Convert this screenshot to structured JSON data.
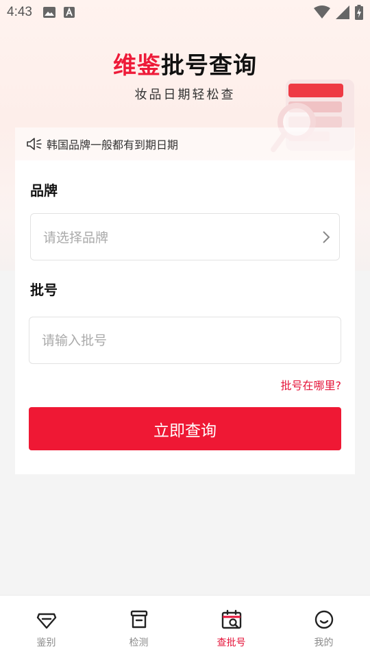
{
  "status_bar": {
    "time": "4:43"
  },
  "header": {
    "logo_brand": "维鉴",
    "logo_title": "批号查询",
    "subtitle": "妆品日期轻松查"
  },
  "notice": {
    "text": "韩国品牌一般都有到期日期"
  },
  "form": {
    "brand_label": "品牌",
    "brand_placeholder": "请选择品牌",
    "batch_label": "批号",
    "batch_placeholder": "请输入批号",
    "help_link": "批号在哪里?",
    "submit_label": "立即查询"
  },
  "tab_bar": {
    "items": [
      {
        "label": "鉴别",
        "icon": "diamond-icon",
        "active": false
      },
      {
        "label": "检测",
        "icon": "box-icon",
        "active": false
      },
      {
        "label": "查批号",
        "icon": "calendar-search-icon",
        "active": true
      },
      {
        "label": "我的",
        "icon": "smile-icon",
        "active": false
      }
    ]
  },
  "colors": {
    "accent": "#ef1834",
    "active_tab": "#e5143a"
  }
}
